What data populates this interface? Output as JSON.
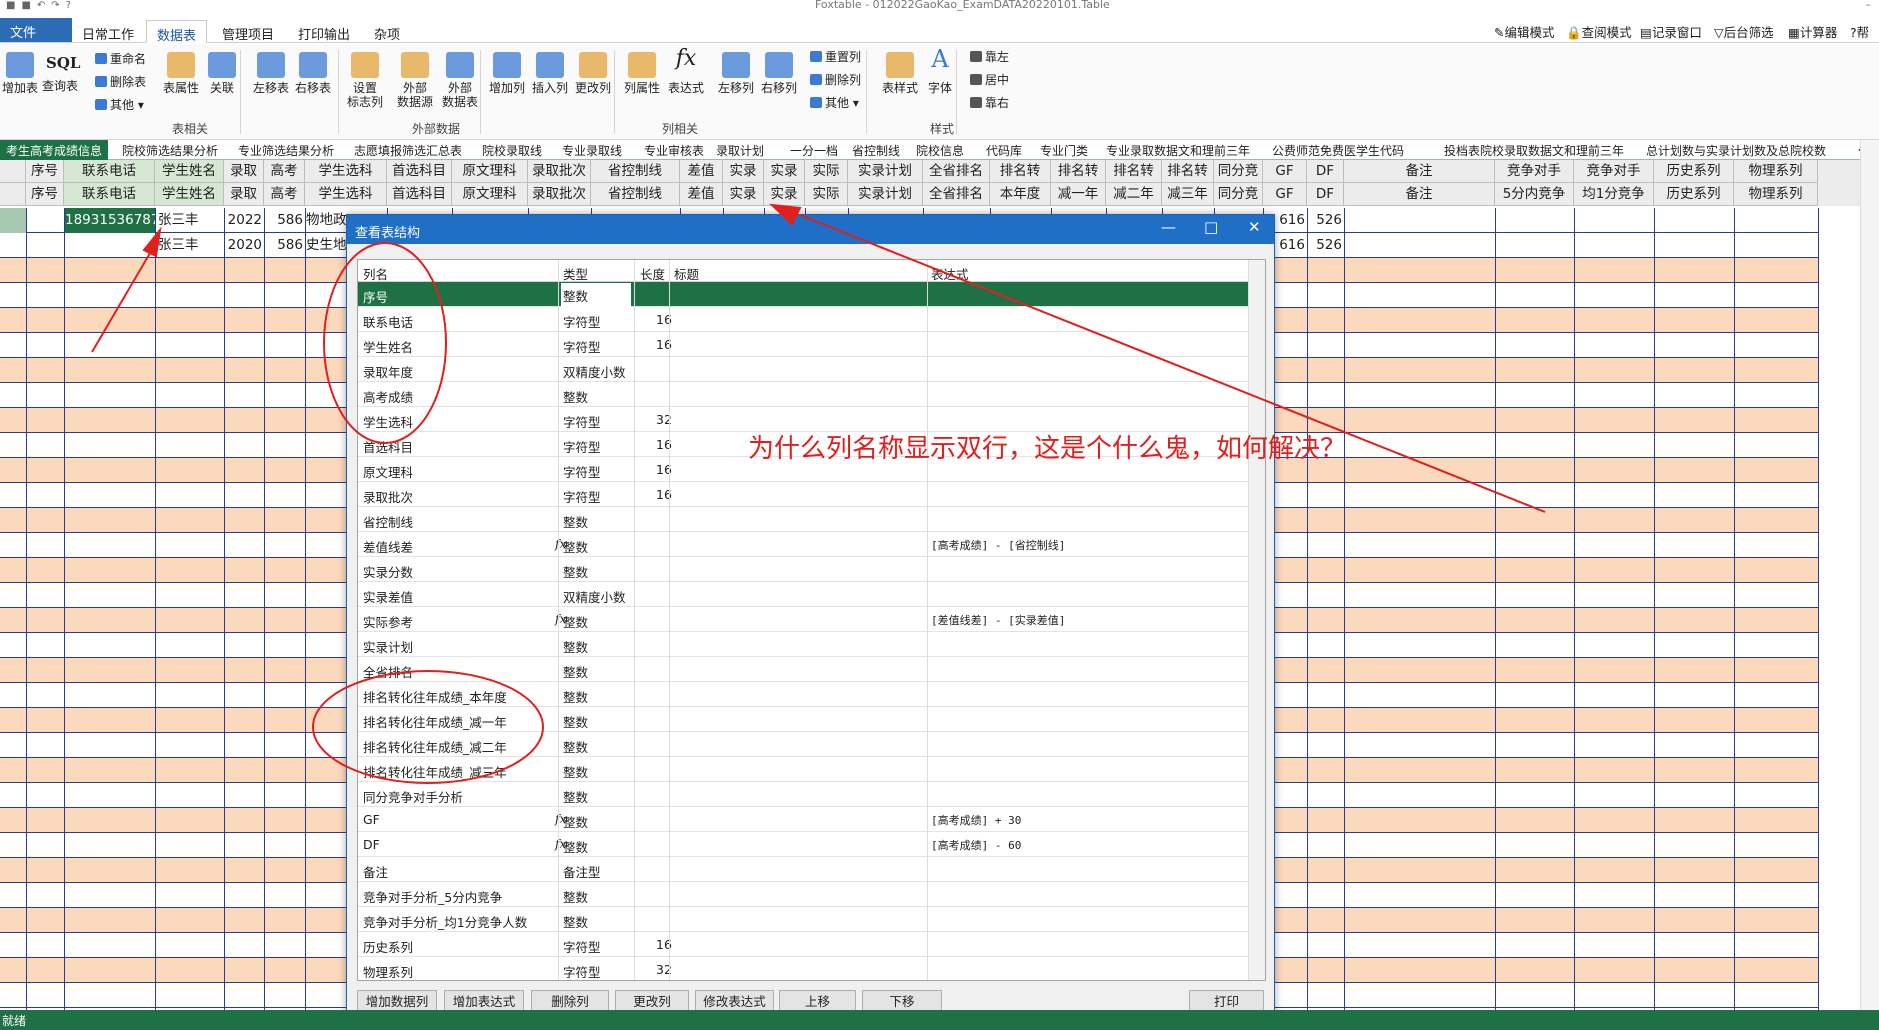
{
  "window": {
    "title": "Foxtable - 012022GaoKao_ExamDATA20220101.Table"
  },
  "menubar": {
    "file": "文件",
    "tabs": [
      "日常工作",
      "数据表",
      "管理项目",
      "打印输出",
      "杂项"
    ],
    "active_tab": "数据表",
    "right": [
      "编辑模式",
      "查阅模式",
      "记录窗口",
      "后台筛选",
      "计算器",
      "帮"
    ]
  },
  "ribbon": {
    "buttons": [
      {
        "label": "增加表",
        "color": "#3b7bd1"
      },
      {
        "label": "查询表",
        "color": "#333"
      },
      {
        "label": "表属性",
        "color": "#e3a33b"
      },
      {
        "label": "关联",
        "color": "#3b7bd1"
      },
      {
        "label": "左移表",
        "color": "#3b7bd1"
      },
      {
        "label": "右移表",
        "color": "#3b7bd1"
      },
      {
        "label": "设置\n标志列",
        "color": "#e3a33b"
      },
      {
        "label": "外部\n数据源",
        "color": "#e3a33b"
      },
      {
        "label": "外部\n数据表",
        "color": "#3b7bd1"
      },
      {
        "label": "增加列",
        "color": "#3b7bd1"
      },
      {
        "label": "插入列",
        "color": "#3b7bd1"
      },
      {
        "label": "更改列",
        "color": "#e3a33b"
      },
      {
        "label": "列属性",
        "color": "#e3a33b"
      },
      {
        "label": "表达式",
        "color": "#222"
      },
      {
        "label": "左移列",
        "color": "#3b7bd1"
      },
      {
        "label": "右移列",
        "color": "#3b7bd1"
      },
      {
        "label": "表样式",
        "color": "#e3a33b"
      },
      {
        "label": "字体",
        "color": "#3b7bd1"
      }
    ],
    "sql_label": "SQL",
    "small": [
      "重命名",
      "删除表",
      "其他",
      "重置列",
      "删除列",
      "其他",
      "靠左",
      "居中",
      "靠右"
    ],
    "groups": [
      "表相关",
      "外部数据",
      "列相关",
      "样式"
    ]
  },
  "tabs": [
    "考生高考成绩信息",
    "院校筛选结果分析",
    "专业筛选结果分析",
    "志愿填报筛选汇总表",
    "院校录取线",
    "专业录取线",
    "专业审核表",
    "录取计划",
    "一分一档",
    "省控制线",
    "院校信息",
    "代码库",
    "专业门类",
    "专业录取数据文和理前三年",
    "公费师范免费医学生代码",
    "投档表",
    "院校录取数据文和理前三年",
    "总计划数与实录计划数及总院校数"
  ],
  "grid": {
    "header1": [
      "序号",
      "联系电话",
      "学生姓名",
      "录取",
      "高考",
      "学生选科",
      "首选科目",
      "原文理科",
      "录取批次",
      "省控制线",
      "差值",
      "实录",
      "实录",
      "实际",
      "实录计划",
      "全省排名",
      "排名转",
      "排名转",
      "排名转",
      "排名转",
      "同分竞",
      "GF",
      "DF",
      "备注",
      "竞争对手",
      "竞争对手",
      "历史系列",
      "物理系列"
    ],
    "header2": [
      "序号",
      "联系电话",
      "学生姓名",
      "录取",
      "高考",
      "学生选科",
      "首选科目",
      "原文理科",
      "录取批次",
      "省控制线",
      "差值",
      "实录",
      "实录",
      "实际",
      "实录计划",
      "全省排名",
      "本年度",
      "减一年",
      "减二年",
      "减三年",
      "同分竞",
      "GF",
      "DF",
      "备注",
      "5分内竞争",
      "均1分竞争",
      "历史系列",
      "物理系列"
    ],
    "rows": [
      {
        "phone": "18931536787",
        "name": "张三丰",
        "year": "2022",
        "score": "586",
        "subject": "物地政",
        "gf": "616",
        "df": "526"
      },
      {
        "phone": "",
        "name": "张三丰",
        "year": "2020",
        "score": "586",
        "subject": "史生地",
        "gf": "616",
        "df": "526"
      }
    ]
  },
  "dialog": {
    "title": "查看表结构",
    "headers": [
      "列名",
      "类型",
      "长度",
      "标题",
      "表达式"
    ],
    "rows": [
      {
        "name": "序号",
        "type": "整数",
        "len": "",
        "expr": "",
        "fx": false
      },
      {
        "name": "联系电话",
        "type": "字符型",
        "len": "16",
        "expr": "",
        "fx": false
      },
      {
        "name": "学生姓名",
        "type": "字符型",
        "len": "16",
        "expr": "",
        "fx": false
      },
      {
        "name": "录取年度",
        "type": "双精度小数",
        "len": "",
        "expr": "",
        "fx": false
      },
      {
        "name": "高考成绩",
        "type": "整数",
        "len": "",
        "expr": "",
        "fx": false
      },
      {
        "name": "学生选科",
        "type": "字符型",
        "len": "32",
        "expr": "",
        "fx": false
      },
      {
        "name": "首选科目",
        "type": "字符型",
        "len": "16",
        "expr": "",
        "fx": false
      },
      {
        "name": "原文理科",
        "type": "字符型",
        "len": "16",
        "expr": "",
        "fx": false
      },
      {
        "name": "录取批次",
        "type": "字符型",
        "len": "16",
        "expr": "",
        "fx": false
      },
      {
        "name": "省控制线",
        "type": "整数",
        "len": "",
        "expr": "",
        "fx": false
      },
      {
        "name": "差值线差",
        "type": "整数",
        "len": "",
        "expr": "[高考成绩] - [省控制线]",
        "fx": true
      },
      {
        "name": "实录分数",
        "type": "整数",
        "len": "",
        "expr": "",
        "fx": false
      },
      {
        "name": "实录差值",
        "type": "双精度小数",
        "len": "",
        "expr": "",
        "fx": false
      },
      {
        "name": "实际参考",
        "type": "整数",
        "len": "",
        "expr": "[差值线差] - [实录差值]",
        "fx": true
      },
      {
        "name": "实录计划",
        "type": "整数",
        "len": "",
        "expr": "",
        "fx": false
      },
      {
        "name": "全省排名",
        "type": "整数",
        "len": "",
        "expr": "",
        "fx": false
      },
      {
        "name": "排名转化往年成绩_本年度",
        "type": "整数",
        "len": "",
        "expr": "",
        "fx": false
      },
      {
        "name": "排名转化往年成绩_减一年",
        "type": "整数",
        "len": "",
        "expr": "",
        "fx": false
      },
      {
        "name": "排名转化往年成绩_减二年",
        "type": "整数",
        "len": "",
        "expr": "",
        "fx": false
      },
      {
        "name": "排名转化往年成绩_减三年",
        "type": "整数",
        "len": "",
        "expr": "",
        "fx": false
      },
      {
        "name": "同分竞争对手分析",
        "type": "整数",
        "len": "",
        "expr": "",
        "fx": false
      },
      {
        "name": "GF",
        "type": "整数",
        "len": "",
        "expr": "[高考成绩] + 30",
        "fx": true
      },
      {
        "name": "DF",
        "type": "整数",
        "len": "",
        "expr": "[高考成绩] - 60",
        "fx": true
      },
      {
        "name": "备注",
        "type": "备注型",
        "len": "",
        "expr": "",
        "fx": false
      },
      {
        "name": "竞争对手分析_5分内竞争",
        "type": "整数",
        "len": "",
        "expr": "",
        "fx": false
      },
      {
        "name": "竞争对手分析_均1分竞争人数",
        "type": "整数",
        "len": "",
        "expr": "",
        "fx": false
      },
      {
        "name": "历史系列",
        "type": "字符型",
        "len": "16",
        "expr": "",
        "fx": false
      },
      {
        "name": "物理系列",
        "type": "字符型",
        "len": "32",
        "expr": "",
        "fx": false
      }
    ],
    "buttons": [
      "增加数据列",
      "增加表达式",
      "删除列",
      "更改列",
      "修改表达式",
      "上移",
      "下移",
      "打印"
    ]
  },
  "annotation": {
    "note": "为什么列名称显示双行，这是个什么鬼，如何解决？",
    "color": "#e0201c"
  },
  "status": {
    "text": "就绪"
  }
}
